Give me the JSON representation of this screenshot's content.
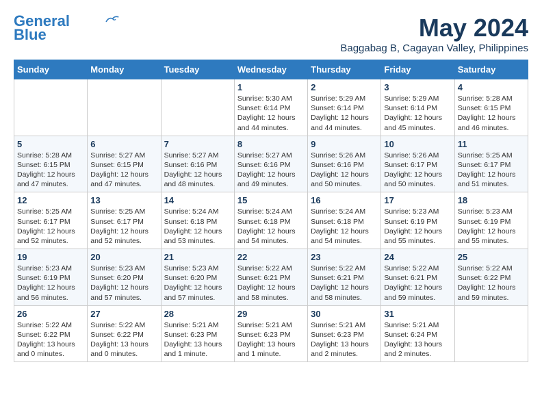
{
  "logo": {
    "line1": "General",
    "line2": "Blue"
  },
  "title": "May 2024",
  "location": "Baggabag B, Cagayan Valley, Philippines",
  "weekdays": [
    "Sunday",
    "Monday",
    "Tuesday",
    "Wednesday",
    "Thursday",
    "Friday",
    "Saturday"
  ],
  "weeks": [
    [
      {
        "day": "",
        "info": ""
      },
      {
        "day": "",
        "info": ""
      },
      {
        "day": "",
        "info": ""
      },
      {
        "day": "1",
        "info": "Sunrise: 5:30 AM\nSunset: 6:14 PM\nDaylight: 12 hours\nand 44 minutes."
      },
      {
        "day": "2",
        "info": "Sunrise: 5:29 AM\nSunset: 6:14 PM\nDaylight: 12 hours\nand 44 minutes."
      },
      {
        "day": "3",
        "info": "Sunrise: 5:29 AM\nSunset: 6:14 PM\nDaylight: 12 hours\nand 45 minutes."
      },
      {
        "day": "4",
        "info": "Sunrise: 5:28 AM\nSunset: 6:15 PM\nDaylight: 12 hours\nand 46 minutes."
      }
    ],
    [
      {
        "day": "5",
        "info": "Sunrise: 5:28 AM\nSunset: 6:15 PM\nDaylight: 12 hours\nand 47 minutes."
      },
      {
        "day": "6",
        "info": "Sunrise: 5:27 AM\nSunset: 6:15 PM\nDaylight: 12 hours\nand 47 minutes."
      },
      {
        "day": "7",
        "info": "Sunrise: 5:27 AM\nSunset: 6:16 PM\nDaylight: 12 hours\nand 48 minutes."
      },
      {
        "day": "8",
        "info": "Sunrise: 5:27 AM\nSunset: 6:16 PM\nDaylight: 12 hours\nand 49 minutes."
      },
      {
        "day": "9",
        "info": "Sunrise: 5:26 AM\nSunset: 6:16 PM\nDaylight: 12 hours\nand 50 minutes."
      },
      {
        "day": "10",
        "info": "Sunrise: 5:26 AM\nSunset: 6:17 PM\nDaylight: 12 hours\nand 50 minutes."
      },
      {
        "day": "11",
        "info": "Sunrise: 5:25 AM\nSunset: 6:17 PM\nDaylight: 12 hours\nand 51 minutes."
      }
    ],
    [
      {
        "day": "12",
        "info": "Sunrise: 5:25 AM\nSunset: 6:17 PM\nDaylight: 12 hours\nand 52 minutes."
      },
      {
        "day": "13",
        "info": "Sunrise: 5:25 AM\nSunset: 6:17 PM\nDaylight: 12 hours\nand 52 minutes."
      },
      {
        "day": "14",
        "info": "Sunrise: 5:24 AM\nSunset: 6:18 PM\nDaylight: 12 hours\nand 53 minutes."
      },
      {
        "day": "15",
        "info": "Sunrise: 5:24 AM\nSunset: 6:18 PM\nDaylight: 12 hours\nand 54 minutes."
      },
      {
        "day": "16",
        "info": "Sunrise: 5:24 AM\nSunset: 6:18 PM\nDaylight: 12 hours\nand 54 minutes."
      },
      {
        "day": "17",
        "info": "Sunrise: 5:23 AM\nSunset: 6:19 PM\nDaylight: 12 hours\nand 55 minutes."
      },
      {
        "day": "18",
        "info": "Sunrise: 5:23 AM\nSunset: 6:19 PM\nDaylight: 12 hours\nand 55 minutes."
      }
    ],
    [
      {
        "day": "19",
        "info": "Sunrise: 5:23 AM\nSunset: 6:19 PM\nDaylight: 12 hours\nand 56 minutes."
      },
      {
        "day": "20",
        "info": "Sunrise: 5:23 AM\nSunset: 6:20 PM\nDaylight: 12 hours\nand 57 minutes."
      },
      {
        "day": "21",
        "info": "Sunrise: 5:23 AM\nSunset: 6:20 PM\nDaylight: 12 hours\nand 57 minutes."
      },
      {
        "day": "22",
        "info": "Sunrise: 5:22 AM\nSunset: 6:21 PM\nDaylight: 12 hours\nand 58 minutes."
      },
      {
        "day": "23",
        "info": "Sunrise: 5:22 AM\nSunset: 6:21 PM\nDaylight: 12 hours\nand 58 minutes."
      },
      {
        "day": "24",
        "info": "Sunrise: 5:22 AM\nSunset: 6:21 PM\nDaylight: 12 hours\nand 59 minutes."
      },
      {
        "day": "25",
        "info": "Sunrise: 5:22 AM\nSunset: 6:22 PM\nDaylight: 12 hours\nand 59 minutes."
      }
    ],
    [
      {
        "day": "26",
        "info": "Sunrise: 5:22 AM\nSunset: 6:22 PM\nDaylight: 13 hours\nand 0 minutes."
      },
      {
        "day": "27",
        "info": "Sunrise: 5:22 AM\nSunset: 6:22 PM\nDaylight: 13 hours\nand 0 minutes."
      },
      {
        "day": "28",
        "info": "Sunrise: 5:21 AM\nSunset: 6:23 PM\nDaylight: 13 hours\nand 1 minute."
      },
      {
        "day": "29",
        "info": "Sunrise: 5:21 AM\nSunset: 6:23 PM\nDaylight: 13 hours\nand 1 minute."
      },
      {
        "day": "30",
        "info": "Sunrise: 5:21 AM\nSunset: 6:23 PM\nDaylight: 13 hours\nand 2 minutes."
      },
      {
        "day": "31",
        "info": "Sunrise: 5:21 AM\nSunset: 6:24 PM\nDaylight: 13 hours\nand 2 minutes."
      },
      {
        "day": "",
        "info": ""
      }
    ]
  ]
}
